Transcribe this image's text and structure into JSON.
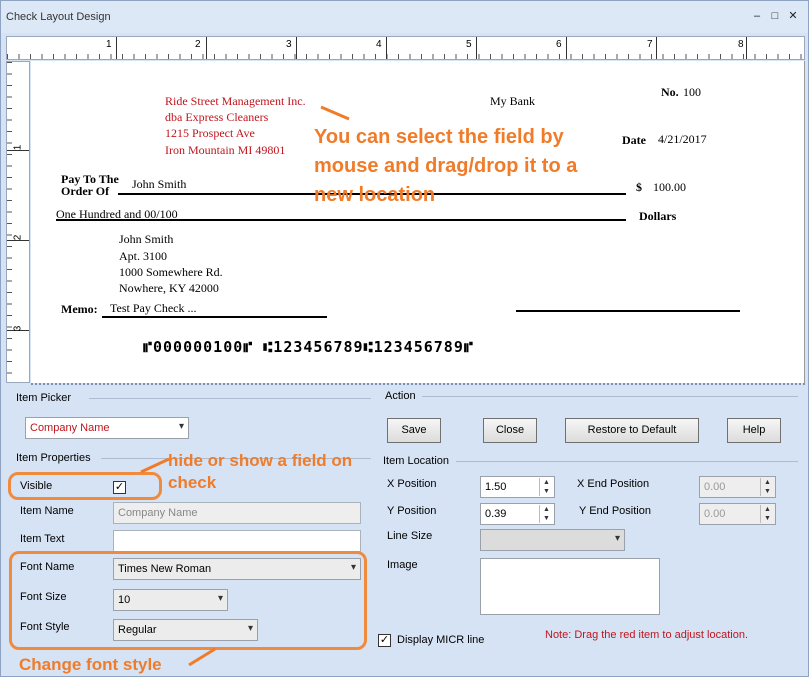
{
  "window": {
    "title": "Check Layout Design",
    "controls": [
      "–",
      "□",
      "✕"
    ]
  },
  "ruler": {
    "h_numbers": [
      "1",
      "2",
      "3",
      "4",
      "5",
      "6",
      "7",
      "8"
    ],
    "v_numbers": [
      "1",
      "2",
      "3"
    ]
  },
  "check": {
    "company": [
      "Ride Street Management Inc.",
      "dba Express Cleaners",
      "1215 Prospect Ave",
      "Iron Mountain MI 49801"
    ],
    "bank": "My Bank",
    "no_label": "No.",
    "no_value": "100",
    "date_label": "Date",
    "date_value": "4/21/2017",
    "pay_to_line1": "Pay To The",
    "pay_to_line2": "Order Of",
    "payee": "John Smith",
    "dollar_sign": "$",
    "amount": "100.00",
    "amount_words": "One Hundred  and 00/100",
    "dollars_label": "Dollars",
    "address": [
      "John Smith",
      "Apt. 3100",
      "1000 Somewhere Rd.",
      "Nowhere, KY 42000"
    ],
    "memo_label": "Memo:",
    "memo_value": "Test Pay Check ...",
    "micr": "⑈000000100⑈ ⑆123456789⑆123456789⑈"
  },
  "annotations": {
    "drag": [
      "You can select the field by",
      "mouse and drag/drop it to a",
      "new location"
    ],
    "visible": [
      "hide or show a field on",
      "check"
    ],
    "font": "Change font style"
  },
  "item_picker": {
    "label": "Item Picker",
    "value": "Company Name"
  },
  "item_properties": {
    "label": "Item Properties",
    "visible_label": "Visible",
    "visible_checked": "✓",
    "item_name_label": "Item Name",
    "item_name_value": "Company Name",
    "item_text_label": "Item Text",
    "item_text_value": "",
    "font_name_label": "Font Name",
    "font_name_value": "Times New Roman",
    "font_size_label": "Font Size",
    "font_size_value": "10",
    "font_style_label": "Font Style",
    "font_style_value": "Regular"
  },
  "action": {
    "label": "Action",
    "save": "Save",
    "close": "Close",
    "restore": "Restore to Default",
    "help": "Help"
  },
  "item_location": {
    "label": "Item Location",
    "x_label": "X Position",
    "x_value": "1.50",
    "y_label": "Y Position",
    "y_value": "0.39",
    "x_end_label": "X End Position",
    "x_end_value": "0.00",
    "y_end_label": "Y End Position",
    "y_end_value": "0.00",
    "line_size_label": "Line Size",
    "line_size_value": "",
    "image_label": "Image",
    "micr_label": "Display MICR line",
    "micr_checked": "✓",
    "note": "Note:  Drag the red item to adjust location."
  },
  "colors": {
    "accent": "#f07c2a",
    "red_item": "#c0151d",
    "panel": "#d6e3f4"
  }
}
